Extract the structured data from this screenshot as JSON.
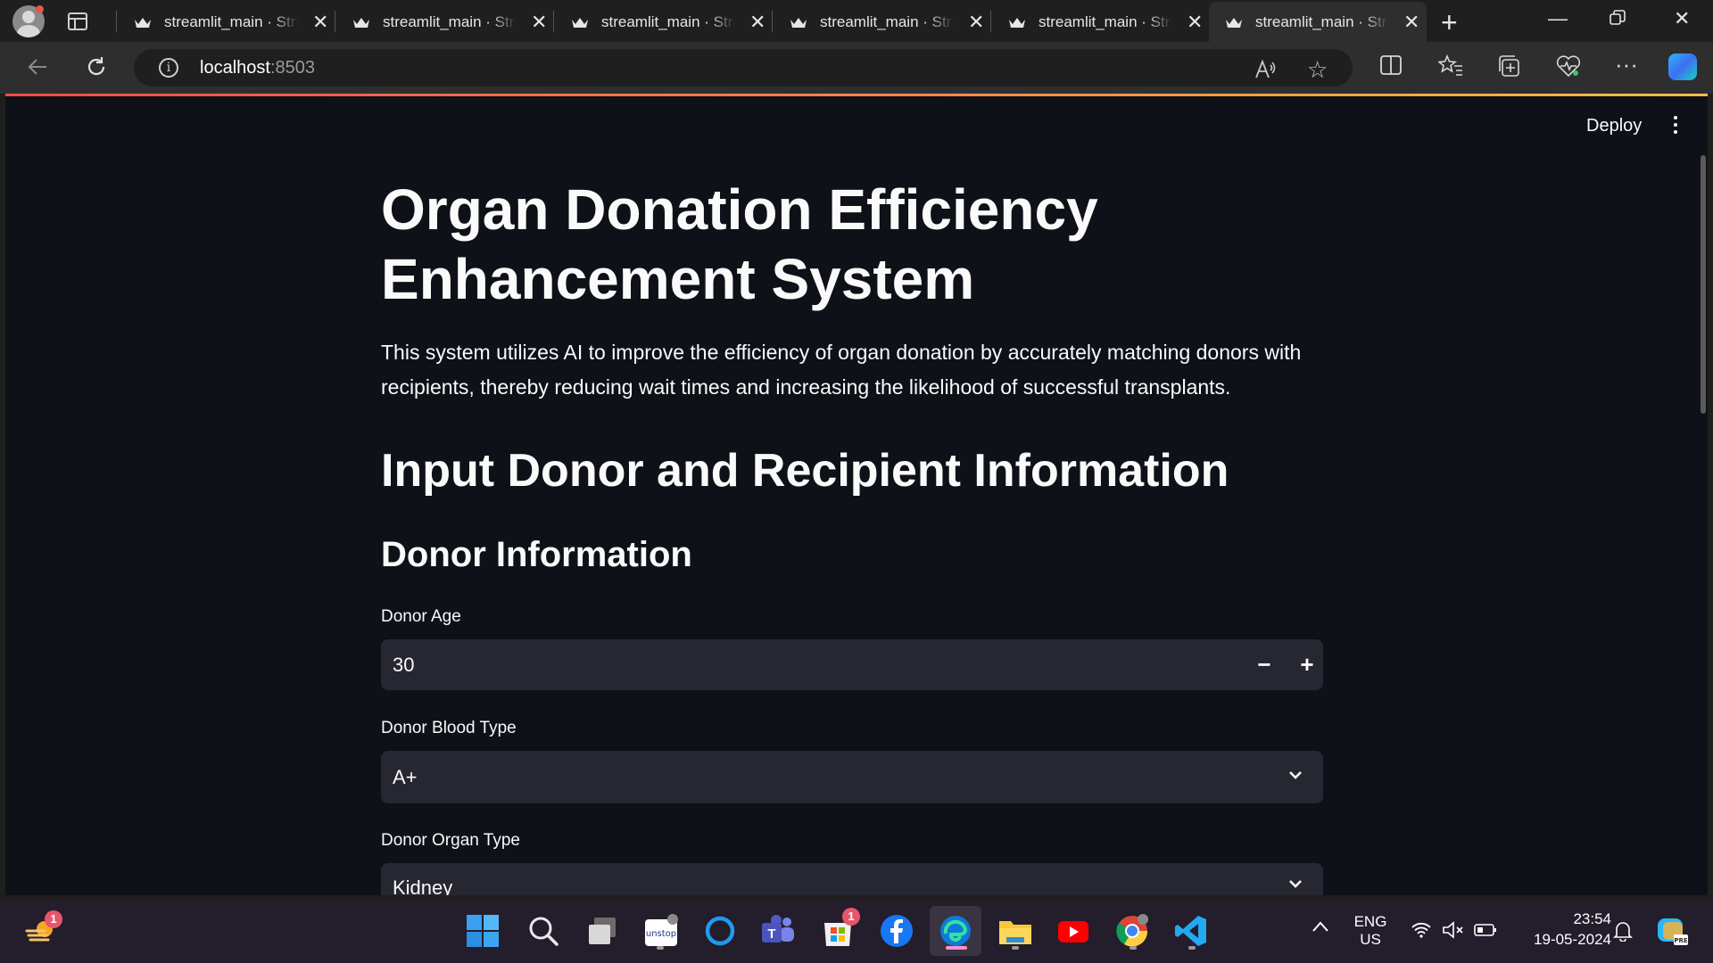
{
  "browser": {
    "tabs": [
      {
        "title": "streamlit_main · Streamlit"
      },
      {
        "title": "streamlit_main · Streamlit"
      },
      {
        "title": "streamlit_main · Streamlit"
      },
      {
        "title": "streamlit_main · Streamlit"
      },
      {
        "title": "streamlit_main · Streamlit"
      },
      {
        "title": "streamlit_main · Streamlit"
      }
    ],
    "active_tab": 5,
    "url_host": "localhost",
    "url_port": ":8503"
  },
  "app": {
    "deploy_label": "Deploy",
    "title": "Organ Donation Efficiency Enhancement System",
    "description": "This system utilizes AI to improve the efficiency of organ donation by accurately matching donors with recipients, thereby reducing wait times and increasing the likelihood of successful transplants.",
    "section_heading": "Input Donor and Recipient Information",
    "subsection_heading": "Donor Information",
    "fields": {
      "donor_age": {
        "label": "Donor Age",
        "value": "30",
        "minus": "−",
        "plus": "+"
      },
      "donor_blood_type": {
        "label": "Donor Blood Type",
        "value": "A+"
      },
      "donor_organ_type": {
        "label": "Donor Organ Type",
        "value": "Kidney"
      }
    }
  },
  "taskbar": {
    "weather_badge": "1",
    "store_badge": "1",
    "language_line1": "ENG",
    "language_line2": "US",
    "time": "23:54",
    "date": "19-05-2024"
  },
  "colors": {
    "page_bg": "#0e1117",
    "input_bg": "#262730",
    "accent_red": "#ff4b4b",
    "accent_yellow": "#ffbd45",
    "taskbar_bg": "#241d2b"
  }
}
